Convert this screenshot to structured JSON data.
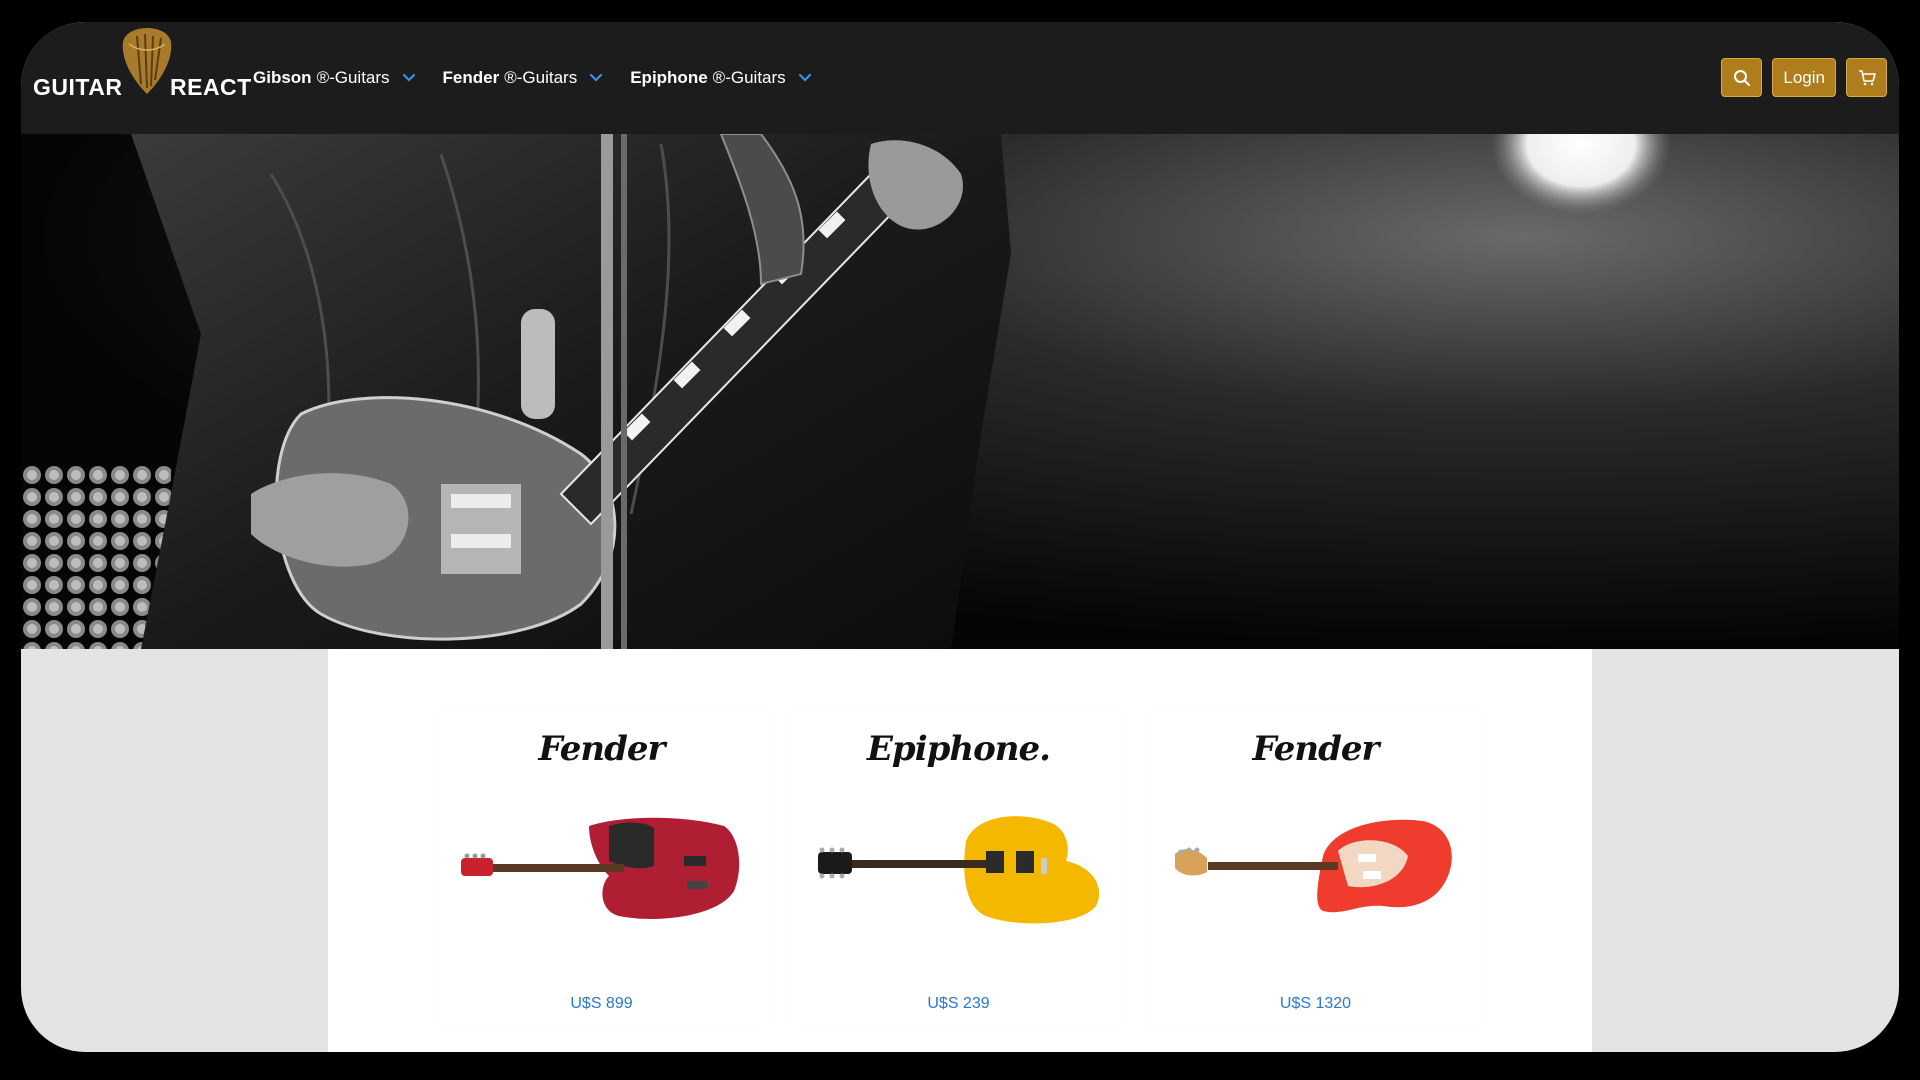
{
  "brand": {
    "left": "GUITAR",
    "right": "REACT"
  },
  "nav": {
    "items": [
      {
        "brand": "Gibson",
        "suffix": "®-Guitars"
      },
      {
        "brand": "Fender",
        "suffix": "®-Guitars"
      },
      {
        "brand": "Epiphone",
        "suffix": "®-Guitars"
      }
    ],
    "login_label": "Login"
  },
  "products": [
    {
      "logo": "Fender",
      "price": "U$S 899",
      "body_color": "#b01e33"
    },
    {
      "logo": "Epiphone.",
      "price": "U$S 239",
      "body_color": "#f5b800"
    },
    {
      "logo": "Fender",
      "price": "U$S 1320",
      "body_color": "#f03c2e"
    }
  ],
  "colors": {
    "navbar": "#1c1c1c",
    "accent": "#b07d1c",
    "price_link": "#2a78c8"
  }
}
